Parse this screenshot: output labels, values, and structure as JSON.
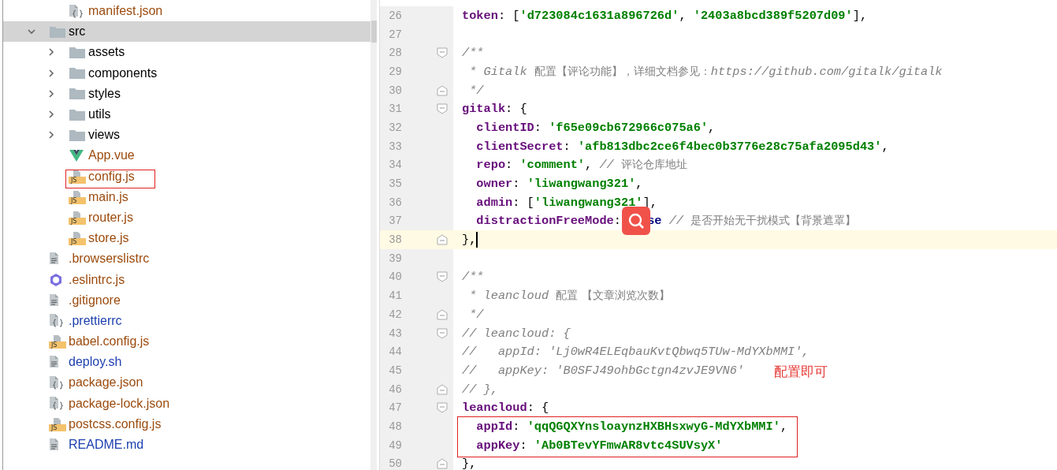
{
  "project_tree": {
    "items": [
      {
        "children": [
          {
            "name": "manifest.json",
            "kind": "json",
            "color": "#9c4b0e",
            "selected": false
          }
        ]
      },
      {
        "name": "src",
        "kind": "folder",
        "color": "#000000",
        "selected": true,
        "expanded": true,
        "children": [
          {
            "name": "assets",
            "kind": "folder",
            "color": "#000000",
            "selected": false,
            "expanded": false
          },
          {
            "name": "components",
            "kind": "folder",
            "color": "#000000",
            "selected": false,
            "expanded": false
          },
          {
            "name": "styles",
            "kind": "folder",
            "color": "#000000",
            "selected": false,
            "expanded": false
          },
          {
            "name": "utils",
            "kind": "folder",
            "color": "#000000",
            "selected": false,
            "expanded": false
          },
          {
            "name": "views",
            "kind": "folder",
            "color": "#000000",
            "selected": false,
            "expanded": false
          },
          {
            "name": "App.vue",
            "kind": "vue",
            "color": "#9c4b0e",
            "selected": false
          },
          {
            "name": "config.js",
            "kind": "js",
            "badge": "JS",
            "color": "#9c4b0e",
            "selected": false,
            "annotated": true
          },
          {
            "name": "main.js",
            "kind": "js",
            "badge": "JS",
            "color": "#9c4b0e",
            "selected": false
          },
          {
            "name": "router.js",
            "kind": "js",
            "badge": "JS",
            "color": "#9c4b0e",
            "selected": false
          },
          {
            "name": "store.js",
            "kind": "js",
            "badge": "JS",
            "color": "#9c4b0e",
            "selected": false
          }
        ]
      },
      {
        "name": ".browserslistrc",
        "kind": "text",
        "color": "#9c4b0e",
        "selected": false
      },
      {
        "name": ".eslintrc.js",
        "kind": "eslint",
        "color": "#9c4b0e",
        "selected": false
      },
      {
        "name": ".gitignore",
        "kind": "text",
        "color": "#9c4b0e",
        "selected": false
      },
      {
        "name": ".prettierrc",
        "kind": "json",
        "color": "#1d3fb0",
        "selected": false
      },
      {
        "name": "babel.config.js",
        "kind": "js",
        "badge": "JS",
        "color": "#9c4b0e",
        "selected": false
      },
      {
        "name": "deploy.sh",
        "kind": "text",
        "color": "#1d3fb0",
        "selected": false
      },
      {
        "name": "package.json",
        "kind": "json",
        "color": "#9c4b0e",
        "selected": false
      },
      {
        "name": "package-lock.json",
        "kind": "json",
        "color": "#9c4b0e",
        "selected": false
      },
      {
        "name": "postcss.config.js",
        "kind": "js",
        "badge": "JS",
        "color": "#9c4b0e",
        "selected": false
      },
      {
        "name": "README.md",
        "kind": "text",
        "color": "#1d3fb0",
        "selected": false
      }
    ]
  },
  "editor": {
    "lines": [
      {
        "number": "26",
        "tokens": [
          {
            "kind": "key",
            "text": "token"
          },
          {
            "kind": "punct",
            "text": ": ["
          },
          {
            "kind": "string",
            "text": "'d723084c1631a896726d'"
          },
          {
            "kind": "punct",
            "text": ", "
          },
          {
            "kind": "string",
            "text": "'2403a8bcd389f5207d09'"
          },
          {
            "kind": "punct",
            "text": "],"
          }
        ]
      },
      {
        "number": "27"
      },
      {
        "number": "28",
        "fold_start": true,
        "tokens": [
          {
            "kind": "comment",
            "text": "/**"
          }
        ]
      },
      {
        "number": "29",
        "tokens": [
          {
            "kind": "comment",
            "text": " * Gitalk "
          },
          {
            "kind": "comment-cjk",
            "text": "配置【评论功能】，详细文档参见："
          },
          {
            "kind": "comment",
            "text": "https://github.com/gitalk/gitalk"
          }
        ]
      },
      {
        "number": "30",
        "fold_end": true,
        "tokens": [
          {
            "kind": "comment",
            "text": " */"
          }
        ]
      },
      {
        "number": "31",
        "fold_start": true,
        "tokens": [
          {
            "kind": "key",
            "text": "gitalk"
          },
          {
            "kind": "punct",
            "text": ": {"
          }
        ]
      },
      {
        "number": "32",
        "tokens": [
          {
            "kind": "key",
            "text": "  clientID"
          },
          {
            "kind": "punct",
            "text": ": "
          },
          {
            "kind": "string",
            "text": "'f65e09cb672966c075a6'"
          },
          {
            "kind": "punct",
            "text": ","
          }
        ]
      },
      {
        "number": "33",
        "tokens": [
          {
            "kind": "key",
            "text": "  clientSecret"
          },
          {
            "kind": "punct",
            "text": ": "
          },
          {
            "kind": "string",
            "text": "'afb813dbc2ce6f4bec0b3776e28c75afa2095d43'"
          },
          {
            "kind": "punct",
            "text": ","
          }
        ]
      },
      {
        "number": "34",
        "tokens": [
          {
            "kind": "key",
            "text": "  repo"
          },
          {
            "kind": "punct",
            "text": ": "
          },
          {
            "kind": "string",
            "text": "'comment'"
          },
          {
            "kind": "punct",
            "text": ", "
          },
          {
            "kind": "comment",
            "text": "// "
          },
          {
            "kind": "comment-cjk",
            "text": "评论仓库地址"
          }
        ]
      },
      {
        "number": "35",
        "tokens": [
          {
            "kind": "key",
            "text": "  owner"
          },
          {
            "kind": "punct",
            "text": ": "
          },
          {
            "kind": "string",
            "text": "'liwangwang321'"
          },
          {
            "kind": "punct",
            "text": ","
          }
        ]
      },
      {
        "number": "36",
        "tokens": [
          {
            "kind": "key",
            "text": "  admin"
          },
          {
            "kind": "punct",
            "text": ": ["
          },
          {
            "kind": "string",
            "text": "'liwangwang321'"
          },
          {
            "kind": "punct",
            "text": "],"
          }
        ]
      },
      {
        "number": "37",
        "tokens": [
          {
            "kind": "key",
            "text": "  distractionFreeMode"
          },
          {
            "kind": "punct",
            "text": ": "
          },
          {
            "kind": "search-badge"
          },
          {
            "kind": "keyword",
            "text": "se"
          },
          {
            "kind": "comment",
            "text": " // "
          },
          {
            "kind": "comment-cjk",
            "text": "是否开始无干扰模式【背景遮罩】"
          }
        ]
      },
      {
        "number": "38",
        "fold_end": true,
        "current": true,
        "tokens": [
          {
            "kind": "punct",
            "text": "},"
          }
        ]
      },
      {
        "number": "39"
      },
      {
        "number": "40",
        "fold_start": true,
        "tokens": [
          {
            "kind": "comment",
            "text": "/**"
          }
        ]
      },
      {
        "number": "41",
        "tokens": [
          {
            "kind": "comment",
            "text": " * leancloud "
          },
          {
            "kind": "comment-cjk",
            "text": "配置 【文章浏览次数】"
          }
        ]
      },
      {
        "number": "42",
        "fold_end": true,
        "tokens": [
          {
            "kind": "comment",
            "text": " */"
          }
        ]
      },
      {
        "number": "43",
        "fold_start": true,
        "tokens": [
          {
            "kind": "comment",
            "text": "// leancloud: {"
          }
        ]
      },
      {
        "number": "44",
        "tokens": [
          {
            "kind": "comment",
            "text": "//   appId: 'Lj0wR4ELEqbauKvtQbwq5TUw-MdYXbMMI',"
          }
        ]
      },
      {
        "number": "45",
        "note": "配置即可",
        "tokens": [
          {
            "kind": "comment",
            "text": "//   appKey: 'B0SFJ49ohbGctgn4zvJE9VN6'"
          }
        ]
      },
      {
        "number": "46",
        "fold_end": true,
        "tokens": [
          {
            "kind": "comment",
            "text": "// },"
          }
        ]
      },
      {
        "number": "47",
        "fold_start": true,
        "tokens": [
          {
            "kind": "key",
            "text": "leancloud"
          },
          {
            "kind": "punct",
            "text": ": {"
          }
        ]
      },
      {
        "number": "48",
        "boxed": true,
        "tokens": [
          {
            "kind": "key",
            "text": "  appId"
          },
          {
            "kind": "punct",
            "text": ": "
          },
          {
            "kind": "string",
            "text": "'qqQGQXYnsloaynzHXBHsxwyG-MdYXbMMI'"
          },
          {
            "kind": "punct",
            "text": ","
          }
        ]
      },
      {
        "number": "49",
        "boxed": true,
        "tokens": [
          {
            "kind": "key",
            "text": "  appKey"
          },
          {
            "kind": "punct",
            "text": ": "
          },
          {
            "kind": "string",
            "text": "'Ab0BTevYFmwAR8vtc4SUVsyX'"
          }
        ]
      },
      {
        "number": "50",
        "fold_end": true,
        "tokens": [
          {
            "kind": "punct",
            "text": "},"
          }
        ]
      }
    ]
  }
}
